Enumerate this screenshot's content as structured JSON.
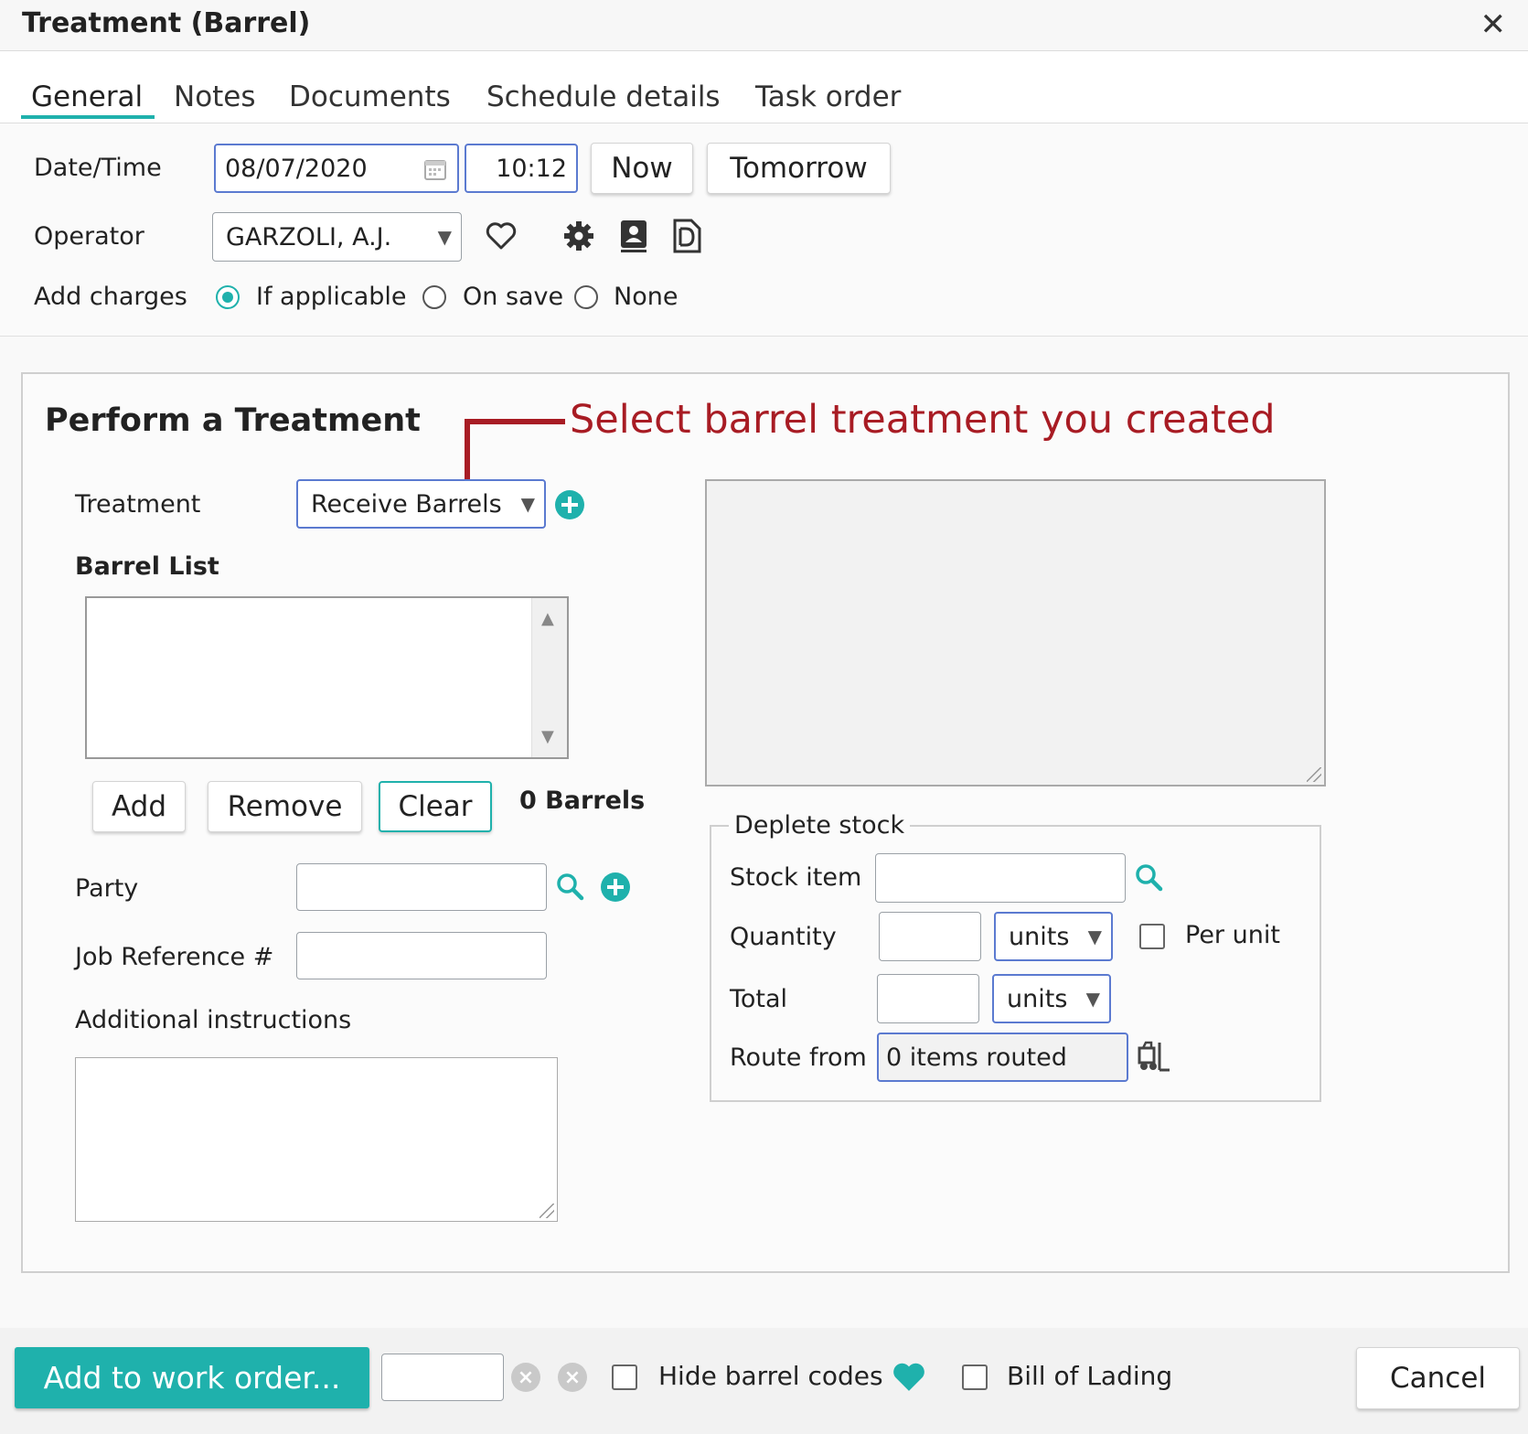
{
  "window": {
    "title": "Treatment (Barrel)"
  },
  "tabs": [
    "General",
    "Notes",
    "Documents",
    "Schedule details",
    "Task order"
  ],
  "general": {
    "datetime_label": "Date/Time",
    "date_value": "08/07/2020",
    "time_value": "10:12",
    "now_label": "Now",
    "tomorrow_label": "Tomorrow",
    "operator_label": "Operator",
    "operator_value": "GARZOLI, A.J.",
    "add_charges_label": "Add charges",
    "charges_options": [
      "If applicable",
      "On save",
      "None"
    ],
    "charges_selected": "If applicable"
  },
  "treatment": {
    "heading": "Perform a Treatment",
    "annotation": "Select barrel treatment you created",
    "treatment_label": "Treatment",
    "treatment_value": "Receive Barrels",
    "barrel_list_label": "Barrel List",
    "add_label": "Add",
    "remove_label": "Remove",
    "clear_label": "Clear",
    "barrel_count": "0 Barrels",
    "party_label": "Party",
    "job_ref_label": "Job Reference #",
    "instructions_label": "Additional instructions"
  },
  "deplete": {
    "legend": "Deplete stock",
    "stock_item_label": "Stock item",
    "quantity_label": "Quantity",
    "quantity_unit": "units",
    "per_unit_label": "Per unit",
    "total_label": "Total",
    "total_unit": "units",
    "route_from_label": "Route from",
    "route_from_value": "0 items routed"
  },
  "footer": {
    "add_to_work_order": "Add to work order...",
    "hide_barrel_codes": "Hide barrel codes",
    "bill_of_lading": "Bill of Lading",
    "cancel": "Cancel"
  },
  "colors": {
    "accent": "#1fb1ac",
    "annotation": "#a81c24"
  },
  "icons": [
    "close-icon",
    "calendar-icon",
    "heart-icon",
    "gear-icon",
    "contact-card-icon",
    "document-icon",
    "plus-circle-icon",
    "search-icon",
    "forklift-icon",
    "clear-circle-icon",
    "heart-filled-icon"
  ]
}
